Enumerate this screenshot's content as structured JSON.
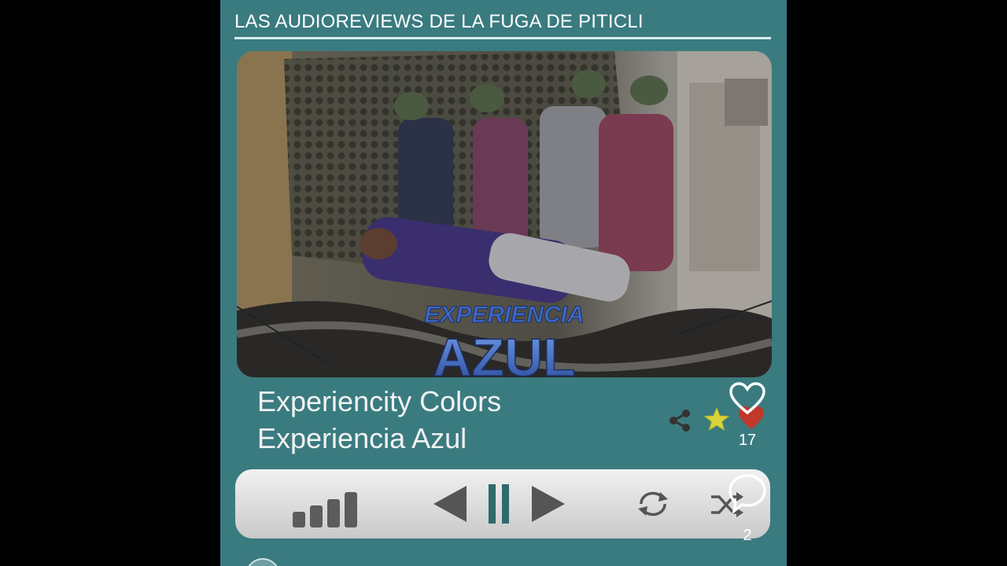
{
  "header": {
    "title": "LAS AUDIOREVIEWS DE LA FUGA DE PITICLI"
  },
  "cover": {
    "logo_line1": "EXPERIENCIA",
    "logo_line2": "AZUL"
  },
  "track": {
    "album": "Experiencity Colors",
    "title": "Experiencia Azul"
  },
  "actions": {
    "share_icon": "share-icon",
    "favorite_icon": "star-icon",
    "like_icon": "heart-outline-icon",
    "likes_count": "17",
    "comment_icon": "comment-bubble-icon",
    "comments_count": "2"
  },
  "player": {
    "state": "playing",
    "buttons": [
      "volume-bars-icon",
      "previous-icon",
      "pause-icon",
      "next-icon",
      "repeat-icon",
      "shuffle-icon"
    ]
  },
  "colors": {
    "panel": "#3a7b80",
    "pause": "#2e6a6c",
    "logo_blue": "#2f54a8"
  }
}
